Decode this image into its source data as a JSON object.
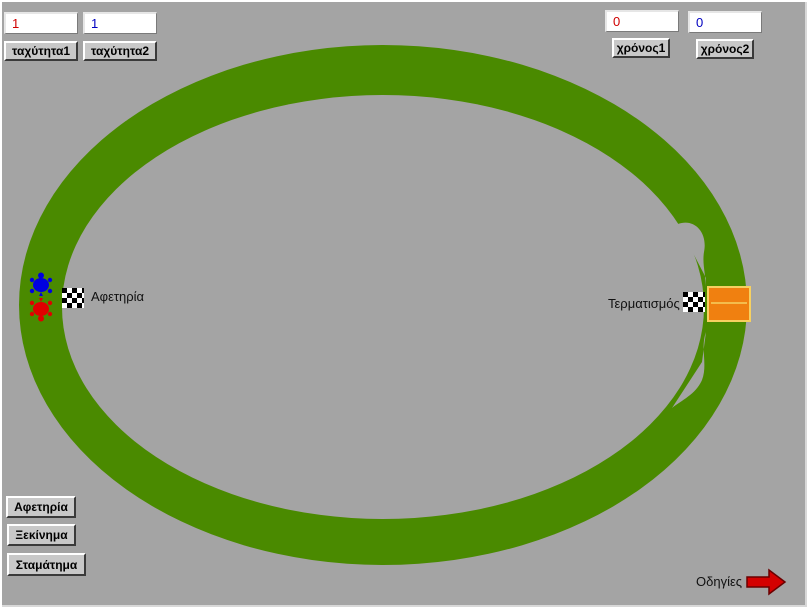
{
  "controls": {
    "speed1_value": "1",
    "speed2_value": "1",
    "speed1_label": "ταχύτητα1",
    "speed2_label": "ταχύτητα2",
    "time1_value": "0",
    "time2_value": "0",
    "time1_label": "χρόνος1",
    "time2_label": "χρόνος2"
  },
  "actions": {
    "start_position_label": "Αφετηρία",
    "start_label": "Ξεκίνημα",
    "stop_label": "Σταμάτημα"
  },
  "track": {
    "start_label": "Αφετηρία",
    "finish_label": "Τερματισμός"
  },
  "help": {
    "label": "Οδηγίες"
  },
  "colors": {
    "board": "#a4a4a4",
    "track": "#4a8a00",
    "player1": "#e00000",
    "player2": "#0000e0",
    "finish_box": "#f08010",
    "arrow": "#d40000"
  },
  "icons": {
    "player1": "red-turtle-icon",
    "player2": "blue-turtle-icon",
    "flags": "checkered-flag-icon",
    "help": "red-arrow-icon"
  }
}
